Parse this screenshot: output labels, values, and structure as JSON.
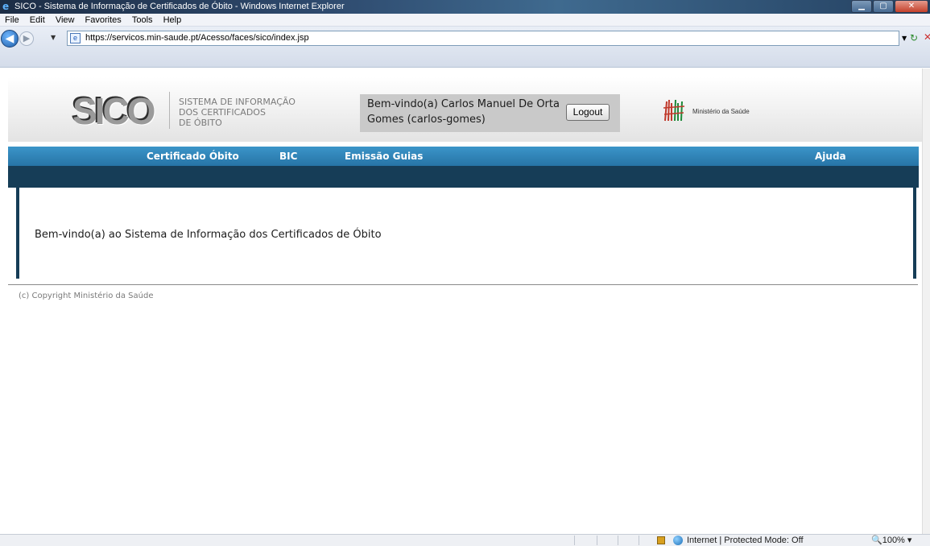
{
  "window": {
    "title": "SICO - Sistema de Informação de Certificados de Óbito - Windows Internet Explorer"
  },
  "menu": [
    "File",
    "Edit",
    "View",
    "Favorites",
    "Tools",
    "Help"
  ],
  "address": {
    "url": "https://servicos.min-saude.pt/Acesso/faces/sico/index.jsp"
  },
  "header": {
    "logo_text": "SICO",
    "subtitle_line1": "SISTEMA DE INFORMAÇÃO",
    "subtitle_line2": "DOS CERTIFICADOS",
    "subtitle_line3": "DE ÓBITO",
    "welcome": "Bem-vindo(a) Carlos Manuel De Orta Gomes (carlos-gomes)",
    "logout_label": "Logout",
    "ministry_name": "Ministério da Saúde"
  },
  "nav": {
    "items": [
      "Certificado Óbito",
      "BIC",
      "Emissão Guias"
    ],
    "help": "Ajuda"
  },
  "content": {
    "welcome_message": "Bem-vindo(a) ao Sistema de Informação dos Certificados de Óbito"
  },
  "footer": {
    "copyright": "(c) Copyright Ministério da Saúde"
  },
  "status": {
    "zone": "Internet | Protected Mode: Off",
    "zoom": "100%"
  },
  "colors": {
    "nav_blue": "#2e86bc",
    "nav_dark": "#163d57"
  }
}
